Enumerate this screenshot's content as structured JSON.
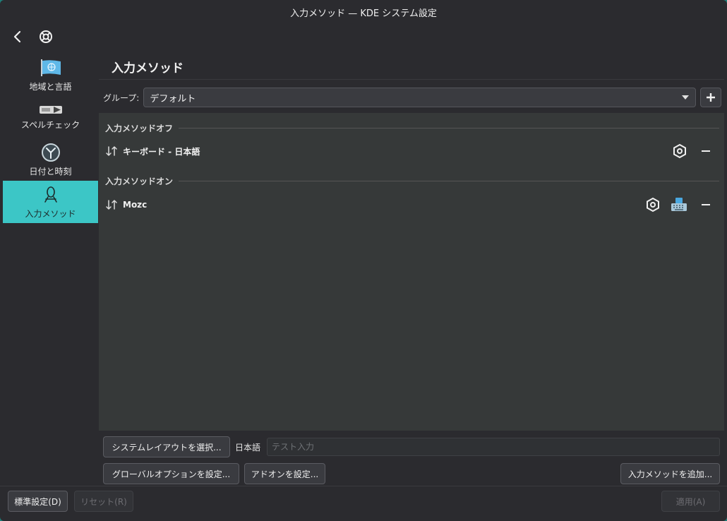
{
  "window": {
    "title": "入力メソッド — KDE システム設定"
  },
  "sidebar": {
    "items": [
      {
        "label": "地域と言語",
        "icon": "flag-icon",
        "active": false
      },
      {
        "label": "スペルチェック",
        "icon": "spellcheck-icon",
        "active": false
      },
      {
        "label": "日付と時刻",
        "icon": "clock-icon",
        "active": false
      },
      {
        "label": "入力メソッド",
        "icon": "input-method-icon",
        "active": true
      }
    ]
  },
  "page": {
    "title": "入力メソッド"
  },
  "group": {
    "label": "グループ:",
    "selected": "デフォルト"
  },
  "sections": {
    "off": {
      "header": "入力メソッドオフ",
      "items": [
        {
          "name": "キーボード - 日本語"
        }
      ]
    },
    "on": {
      "header": "入力メソッドオン",
      "items": [
        {
          "name": "Mozc"
        }
      ]
    }
  },
  "controls": {
    "select_layout": "システムレイアウトを選択...",
    "lang_label": "日本語",
    "test_placeholder": "テスト入力",
    "global_options": "グローバルオプションを設定...",
    "addons": "アドオンを設定...",
    "add_im": "入力メソッドを追加..."
  },
  "footer": {
    "defaults": "標準設定(D)",
    "reset": "リセット(R)",
    "apply": "適用(A)"
  },
  "colors": {
    "accent": "#3cc6c6",
    "window_bg": "#2b2b2f",
    "list_bg": "#363939"
  }
}
